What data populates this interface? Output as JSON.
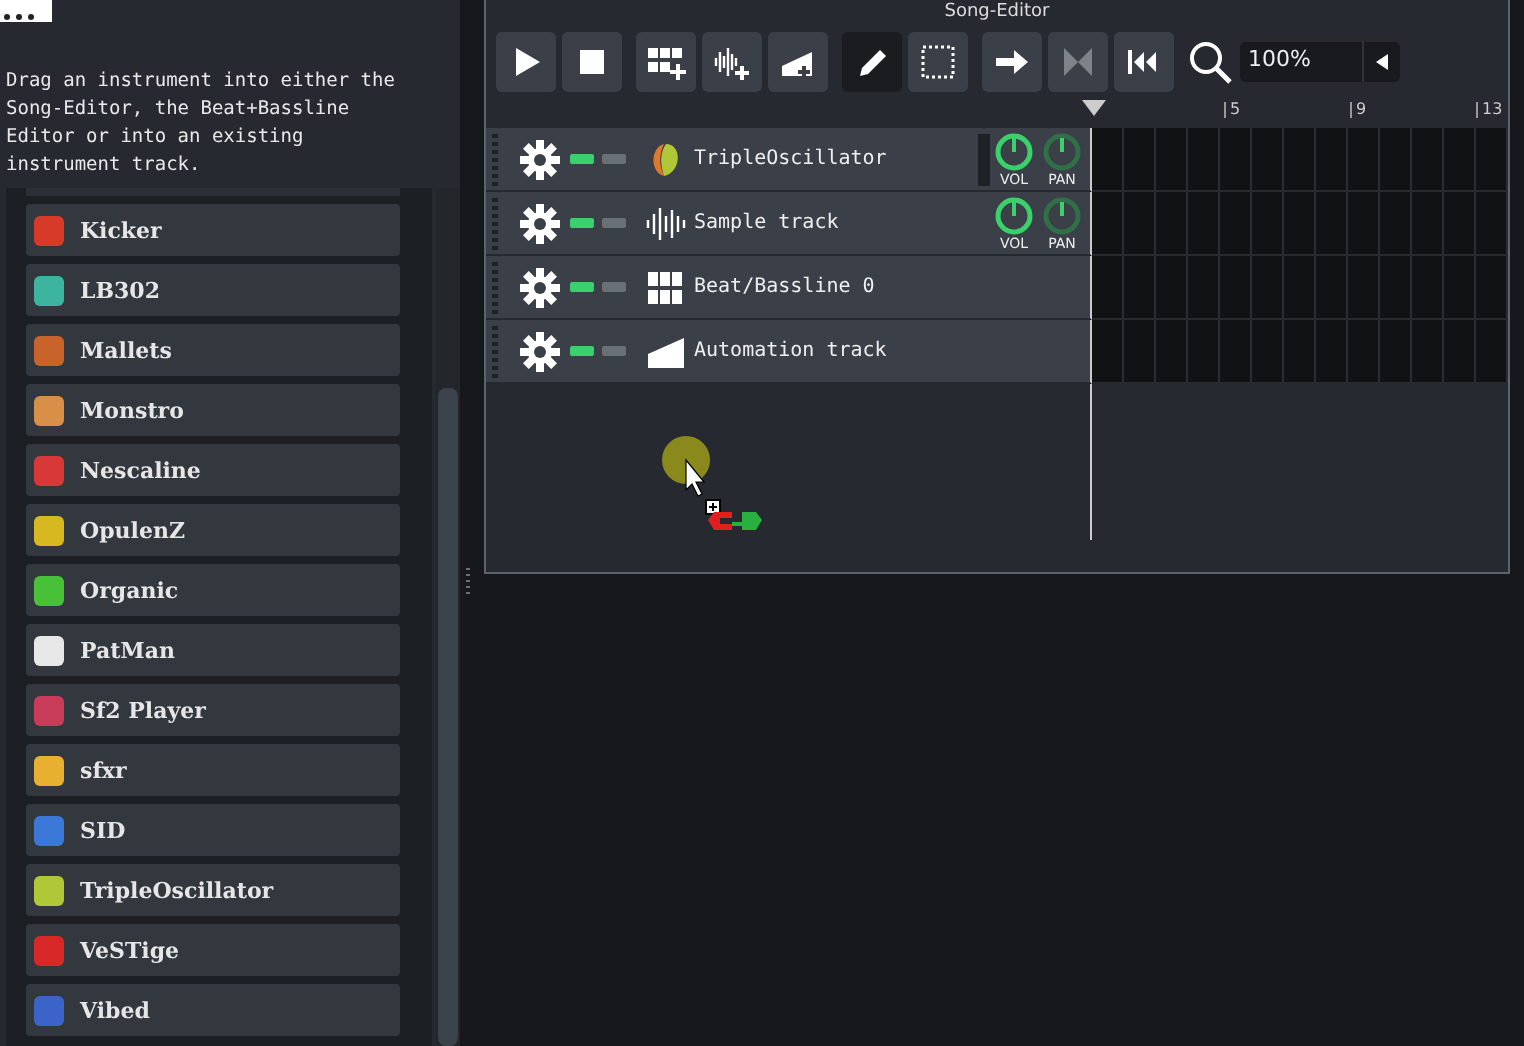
{
  "sidebar": {
    "description": "Drag an instrument into either the Song-Editor, the Beat+Bassline Editor or into an existing instrument track.",
    "instruments": [
      {
        "name": "Kicker",
        "color": "#d83a2a"
      },
      {
        "name": "LB302",
        "color": "#3cb4a0"
      },
      {
        "name": "Mallets",
        "color": "#c8642a"
      },
      {
        "name": "Monstro",
        "color": "#d89048"
      },
      {
        "name": "Nescaline",
        "color": "#d83838"
      },
      {
        "name": "OpulenZ",
        "color": "#d8b820"
      },
      {
        "name": "Organic",
        "color": "#48c038"
      },
      {
        "name": "PatMan",
        "color": "#e8e8e8"
      },
      {
        "name": "Sf2 Player",
        "color": "#c83c5a"
      },
      {
        "name": "sfxr",
        "color": "#e8b030"
      },
      {
        "name": "SID",
        "color": "#3c78d8"
      },
      {
        "name": "TripleOscillator",
        "color": "#b0c838"
      },
      {
        "name": "VeSTige",
        "color": "#d82828"
      },
      {
        "name": "Vibed",
        "color": "#3c64c8"
      }
    ]
  },
  "song_editor": {
    "title": "Song-Editor",
    "toolbar": [
      {
        "kind": "play",
        "selected": false,
        "disabled": false
      },
      {
        "kind": "stop",
        "selected": false,
        "disabled": false
      },
      {
        "kind": "add-bb",
        "selected": false,
        "disabled": false
      },
      {
        "kind": "add-sample",
        "selected": false,
        "disabled": false
      },
      {
        "kind": "add-automation",
        "selected": false,
        "disabled": false
      },
      {
        "kind": "draw",
        "selected": true,
        "disabled": false
      },
      {
        "kind": "select",
        "selected": false,
        "disabled": false
      },
      {
        "kind": "arrow",
        "selected": false,
        "disabled": false
      },
      {
        "kind": "mirror",
        "selected": false,
        "disabled": true
      },
      {
        "kind": "rewind",
        "selected": false,
        "disabled": false
      }
    ],
    "zoom": "100%",
    "ruler": [
      "5",
      "9",
      "13"
    ],
    "tracks": [
      {
        "kind": "instrument",
        "name": "TripleOscillator",
        "muted": false,
        "solo": false,
        "knobs": [
          "VOL",
          "PAN"
        ]
      },
      {
        "kind": "sample",
        "name": "Sample track",
        "muted": false,
        "solo": false,
        "knobs": [
          "VOL",
          "PAN"
        ]
      },
      {
        "kind": "bb",
        "name": "Beat/Bassline 0",
        "muted": false,
        "solo": false
      },
      {
        "kind": "automation",
        "name": "Automation track",
        "muted": false,
        "solo": false
      }
    ]
  }
}
